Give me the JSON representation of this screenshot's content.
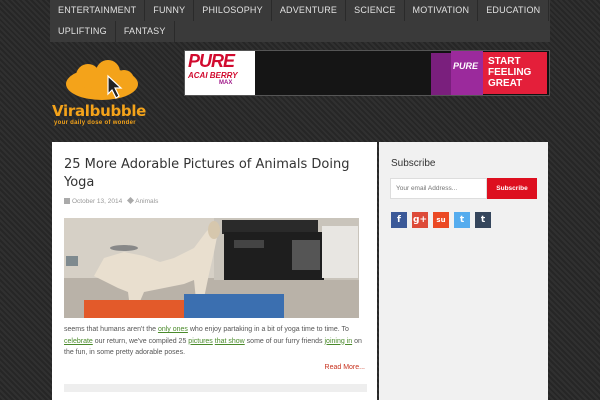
{
  "nav": {
    "items": [
      {
        "label": "ENTERTAINMENT"
      },
      {
        "label": "FUNNY"
      },
      {
        "label": "PHILOSOPHY"
      },
      {
        "label": "ADVENTURE"
      },
      {
        "label": "SCIENCE"
      },
      {
        "label": "MOTIVATION"
      },
      {
        "label": "EDUCATION"
      },
      {
        "label": "UPLIFTING"
      },
      {
        "label": "FANTASY"
      }
    ]
  },
  "logo": {
    "name": "Viralbubble",
    "tagline": "your daily dose of wonder",
    "color": "#f4a31a"
  },
  "ad": {
    "brand": "PURE",
    "product": "ACAI BERRY",
    "max": "MAX",
    "box_label": "PURE",
    "cta": "START FEELING GREAT"
  },
  "post": {
    "title": "25 More Adorable Pictures of Animals Doing Yoga",
    "date": "October 13, 2014",
    "category": "Animals",
    "excerpt_parts": [
      {
        "text": "seems that humans aren't the ",
        "link": false
      },
      {
        "text": "only ones",
        "link": true
      },
      {
        "text": " who enjoy partaking in a bit of yoga time to time. To ",
        "link": false
      },
      {
        "text": "celebrate",
        "link": true
      },
      {
        "text": " our return, we've compiled 25 ",
        "link": false
      },
      {
        "text": "pictures",
        "link": true
      },
      {
        "text": " ",
        "link": false
      },
      {
        "text": "that show",
        "link": true
      },
      {
        "text": " some of our furry friends ",
        "link": false
      },
      {
        "text": "joining in",
        "link": true
      },
      {
        "text": " on the fun, in some pretty adorable poses.",
        "link": false
      }
    ],
    "read_more": "Read More..."
  },
  "sidebar": {
    "title": "Subscribe",
    "email_placeholder": "Your email Address...",
    "subscribe_label": "Subscribe",
    "social": [
      {
        "icon": "facebook-icon",
        "glyph": "f",
        "color": "#3b5998"
      },
      {
        "icon": "google-plus-icon",
        "glyph": "g+",
        "color": "#dd4b39"
      },
      {
        "icon": "stumbleupon-icon",
        "glyph": "su",
        "color": "#eb4924"
      },
      {
        "icon": "twitter-icon",
        "glyph": "t",
        "color": "#55acee"
      },
      {
        "icon": "tumblr-icon",
        "glyph": "t",
        "color": "#35465c"
      }
    ]
  }
}
